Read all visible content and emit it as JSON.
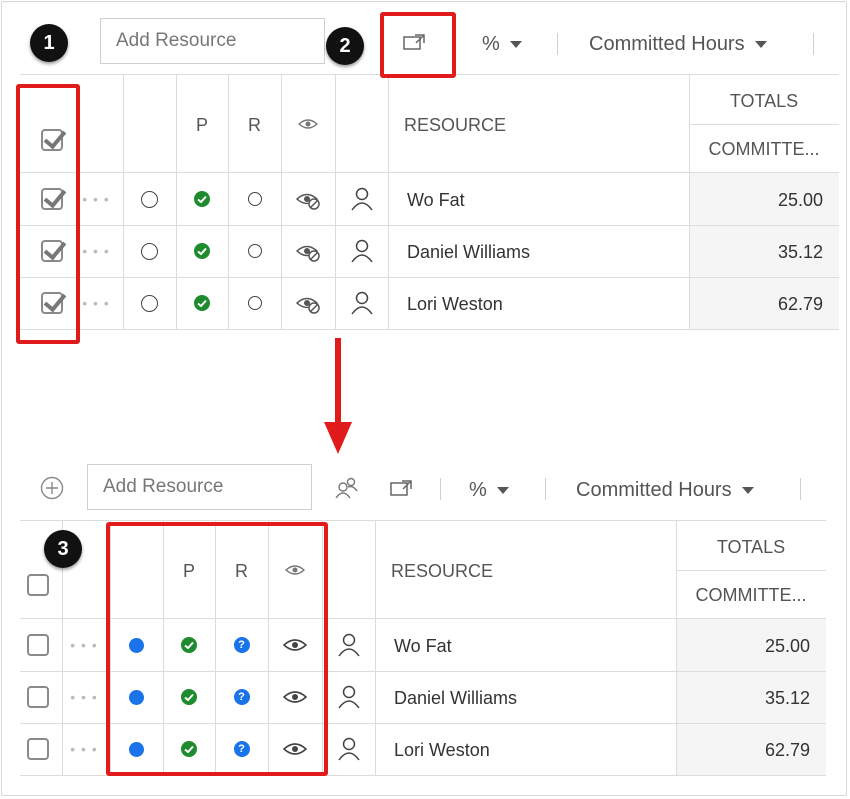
{
  "top": {
    "search_placeholder": "Add Resource",
    "percent_label": "%",
    "view_label": "Committed Hours",
    "header": {
      "p": "P",
      "r": "R",
      "resource": "RESOURCE",
      "totals": "TOTALS",
      "committed": "COMMITTE..."
    },
    "rows": [
      {
        "name": "Wo Fat",
        "value": "25.00"
      },
      {
        "name": "Daniel Williams",
        "value": "35.12"
      },
      {
        "name": "Lori Weston",
        "value": "62.79"
      }
    ]
  },
  "bottom": {
    "search_placeholder": "Add Resource",
    "percent_label": "%",
    "view_label": "Committed Hours",
    "header": {
      "p": "P",
      "r": "R",
      "resource": "RESOURCE",
      "totals": "TOTALS",
      "committed": "COMMITTE..."
    },
    "rows": [
      {
        "name": "Wo Fat",
        "value": "25.00"
      },
      {
        "name": "Daniel Williams",
        "value": "35.12"
      },
      {
        "name": "Lori Weston",
        "value": "62.79"
      }
    ]
  },
  "callouts": {
    "one": "1",
    "two": "2",
    "three": "3"
  },
  "colors": {
    "highlight": "#e11b1b",
    "accent": "#1a73e8",
    "check_green": "#1e8c2e",
    "badge": "#111111"
  }
}
